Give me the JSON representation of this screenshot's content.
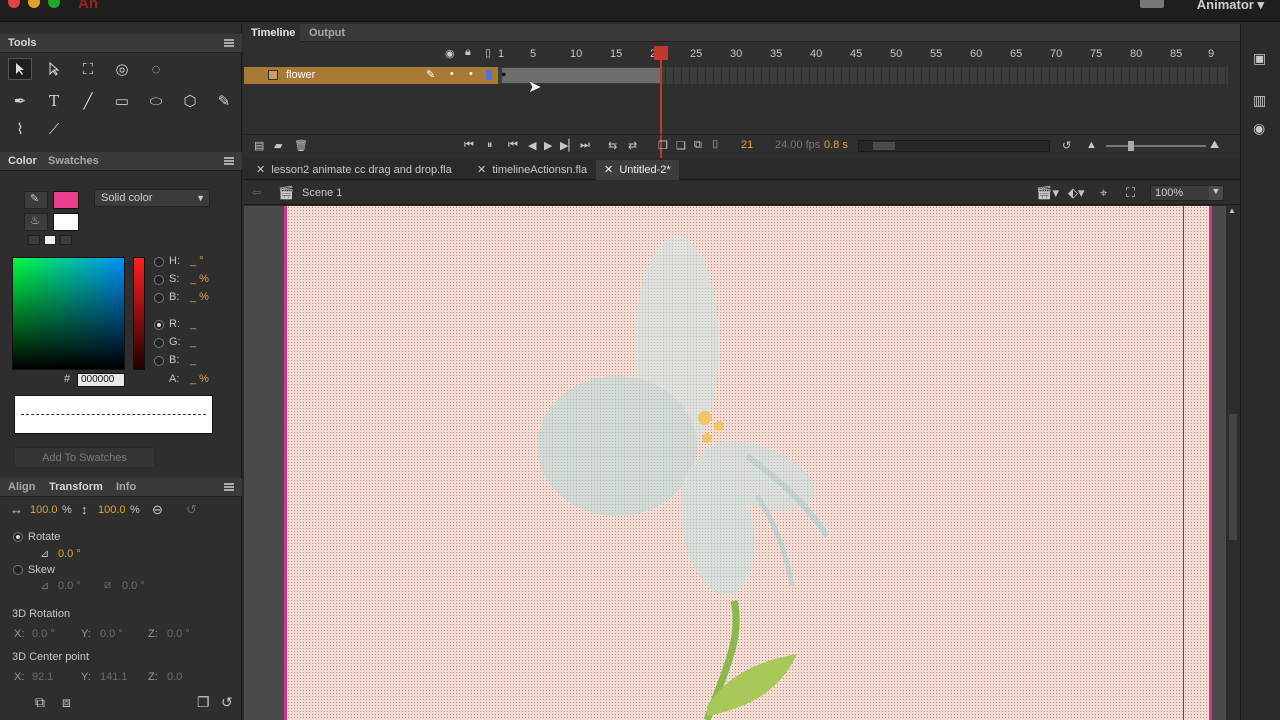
{
  "app": {
    "logo": "An",
    "workspace": "Animator"
  },
  "tools_panel": {
    "title": "Tools"
  },
  "color_panel": {
    "tabs": [
      "Color",
      "Swatches"
    ],
    "fill_color": "#e83e8c",
    "stroke_color": "#ffffff",
    "color_type": "Solid color",
    "fields": {
      "h_label": "H:",
      "h_value": "_ °",
      "s_label": "S:",
      "s_value": "_ %",
      "b_label": "B:",
      "b_value": "_ %",
      "r_label": "R:",
      "r_value": "_",
      "g_label": "G:",
      "g_value": "_",
      "b2_label": "B:",
      "b2_value": "_",
      "a_label": "A:",
      "a_value": "_ %"
    },
    "hex_prefix": "#",
    "hex_value": "000000",
    "add_swatch": "Add To Swatches"
  },
  "transform_panel": {
    "tabs": [
      "Align",
      "Transform",
      "Info"
    ],
    "width_pct": "100.0",
    "height_pct": "100.0",
    "pct_unit": "%",
    "rotate_label": "Rotate",
    "rotate_value": "0.0 °",
    "skew_label": "Skew",
    "skew_x": "0.0 °",
    "skew_y": "0.0 °",
    "rot3d_label": "3D Rotation",
    "rot3d": {
      "x_label": "X:",
      "x": "0.0 °",
      "y_label": "Y:",
      "y": "0.0 °",
      "z_label": "Z:",
      "z": "0.0 °"
    },
    "center_label": "3D Center point",
    "center": {
      "x_label": "X:",
      "x": "92.1",
      "y_label": "Y:",
      "y": "141.1",
      "z_label": "Z:",
      "z": "0.0"
    }
  },
  "timeline": {
    "tabs": [
      "Timeline",
      "Output"
    ],
    "ruler": [
      "1",
      "5",
      "10",
      "15",
      "20",
      "25",
      "30",
      "35",
      "40",
      "45",
      "50",
      "55",
      "60",
      "65",
      "70",
      "75",
      "80",
      "85",
      "9"
    ],
    "layer_name": "flower",
    "current_frame": "21",
    "fps": "24.00 fps",
    "time": "0.8 s"
  },
  "documents": {
    "tabs": [
      "lesson2 animate cc drag and drop.fla",
      "timelineActionsn.fla",
      "Untitled-2*"
    ],
    "active": "Untitled-2*"
  },
  "scene": {
    "name": "Scene 1",
    "zoom": "100%"
  }
}
